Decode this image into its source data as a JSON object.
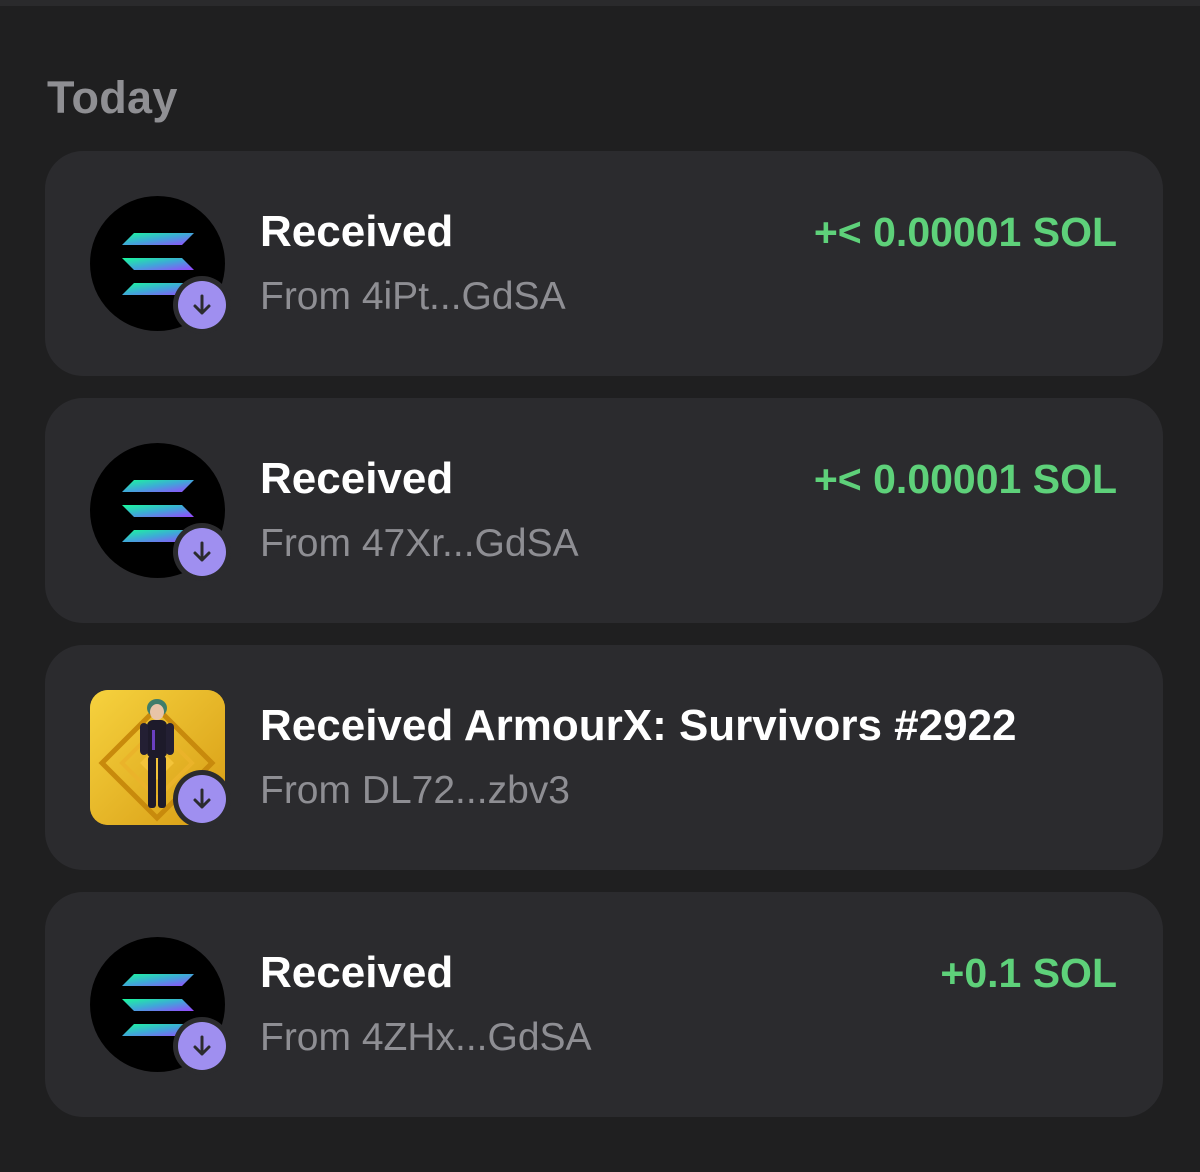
{
  "section": {
    "title": "Today"
  },
  "transactions": [
    {
      "title": "Received",
      "subtitle": "From 4iPt...GdSA",
      "amount": "+< 0.00001 SOL",
      "icon": "solana-logo-icon",
      "badge_icon": "arrow-down-icon"
    },
    {
      "title": "Received",
      "subtitle": "From 47Xr...GdSA",
      "amount": "+< 0.00001 SOL",
      "icon": "solana-logo-icon",
      "badge_icon": "arrow-down-icon"
    },
    {
      "title": "Received ArmourX: Survivors #2922",
      "subtitle": "From DL72...zbv3",
      "amount": "",
      "icon": "nft-thumbnail-icon",
      "badge_icon": "arrow-down-icon"
    },
    {
      "title": "Received",
      "subtitle": "From 4ZHx...GdSA",
      "amount": "+0.1 SOL",
      "icon": "solana-logo-icon",
      "badge_icon": "arrow-down-icon"
    }
  ],
  "colors": {
    "background": "#1f1f20",
    "card": "#2b2b2e",
    "amount_positive": "#5ed17a",
    "badge": "#9f8ff0",
    "section_title": "#8f8f93"
  }
}
